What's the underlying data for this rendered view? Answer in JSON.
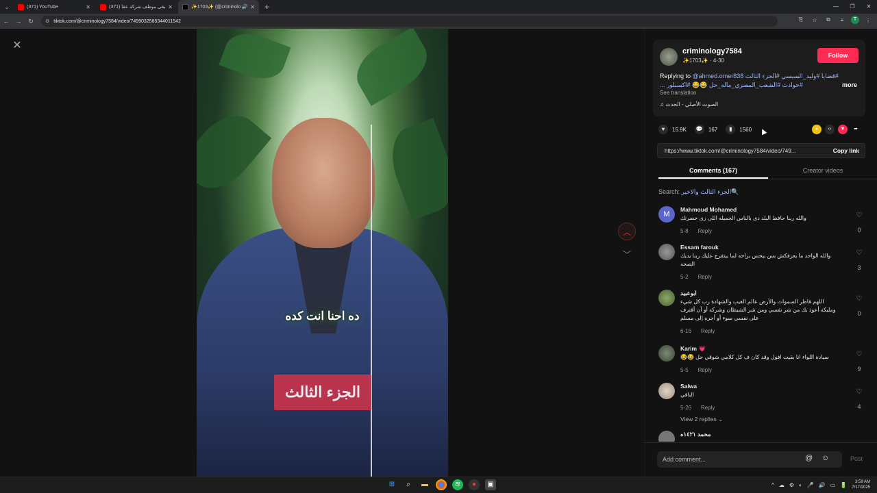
{
  "browser": {
    "tabs": [
      {
        "title": "(371) YouTube",
        "icon": "youtube-icon",
        "color": "#ff0000",
        "active": false
      },
      {
        "title": "(371) لما تبقى موظف شركة عقا...",
        "icon": "youtube-icon",
        "color": "#ff0000",
        "active": false
      },
      {
        "title": "✨1703✨ (@criminology...",
        "icon": "tiktok-icon",
        "color": "#000000",
        "active": true
      }
    ],
    "url": "tiktok.com/@criminology7584/video/7499032585344011542"
  },
  "video": {
    "subtitle_top": "ده احنا انت كده",
    "subtitle_bottom": "الجزء الثالث"
  },
  "post": {
    "username": "criminology7584",
    "subline": "✨1703✨ · 4-30",
    "follow_label": "Follow",
    "caption_prefix": "Replying to ",
    "mention": "@ahmed.omer838",
    "caption_tags": "#قضايا #وليد_السيسي #الجزء الثالث #حوادث #الشعب_المصري_ماله_حل 😂😂 #اكسبلور ...",
    "more_label": "more",
    "see_translation": "See translation",
    "music": "♫  الصوت الأصلي - الحدث",
    "likes": "15.9K",
    "comments_count": "167",
    "saves": "1560",
    "link": "https://www.tiktok.com/@criminology7584/video/749...",
    "copy_link_label": "Copy link"
  },
  "panel_tabs": {
    "comments": "Comments (167)",
    "creator_videos": "Creator videos"
  },
  "search": {
    "label": "Search: ",
    "query": "الجزء الثالث والاخير🔍"
  },
  "comments": [
    {
      "user": "Mahmoud Mohamed",
      "text": "والله ربنا حافظ البلد دى بالناس الجميله اللى زى حضرتك",
      "date": "5-8",
      "likes": "0",
      "avatar_color": "#5a67c8",
      "avatar_letter": "M"
    },
    {
      "user": "Essam farouk",
      "text": "والله الواحد ما يعرفكش بس بيحس براحه لما بيتفرج عليك ربنا يديك الصحه",
      "date": "5-2",
      "likes": "3",
      "avatar_color": "#666666",
      "avatar_letter": ""
    },
    {
      "user": "ابوعبيد",
      "text": "اللهم فاطر السموات والأرض عالم الغيب والشهادة رب كل شيء ومليكه أعوذ بك من شر نفسي ومن شر الشيطان وشركه أو أن أقترف على نفسي سوء أو أجره إلى مسلم",
      "date": "6-16",
      "likes": "0",
      "avatar_color": "#6b8a4a",
      "avatar_letter": ""
    },
    {
      "user": "Karim 💗",
      "text": "سيادة اللواء انا بقيت افول وقد كان ف كل كلامي شوقي حل 😂😂",
      "date": "5-5",
      "likes": "9",
      "avatar_color": "#4d5a4a",
      "avatar_letter": ""
    },
    {
      "user": "Salwa",
      "text": "الباقي",
      "date": "5-26",
      "likes": "4",
      "avatar_color": "#c9bfb2",
      "avatar_letter": ""
    },
    {
      "user": "محمد ١٤٢١ه",
      "text": "",
      "date": "",
      "likes": "",
      "avatar_color": "#888888",
      "avatar_letter": ""
    }
  ],
  "reply_label": "Reply",
  "view_replies": "View 2 replies ⌄",
  "composer": {
    "placeholder": "Add comment...",
    "post_label": "Post"
  },
  "taskbar": {
    "time": "3:59 AM",
    "date": "7/17/2025"
  }
}
